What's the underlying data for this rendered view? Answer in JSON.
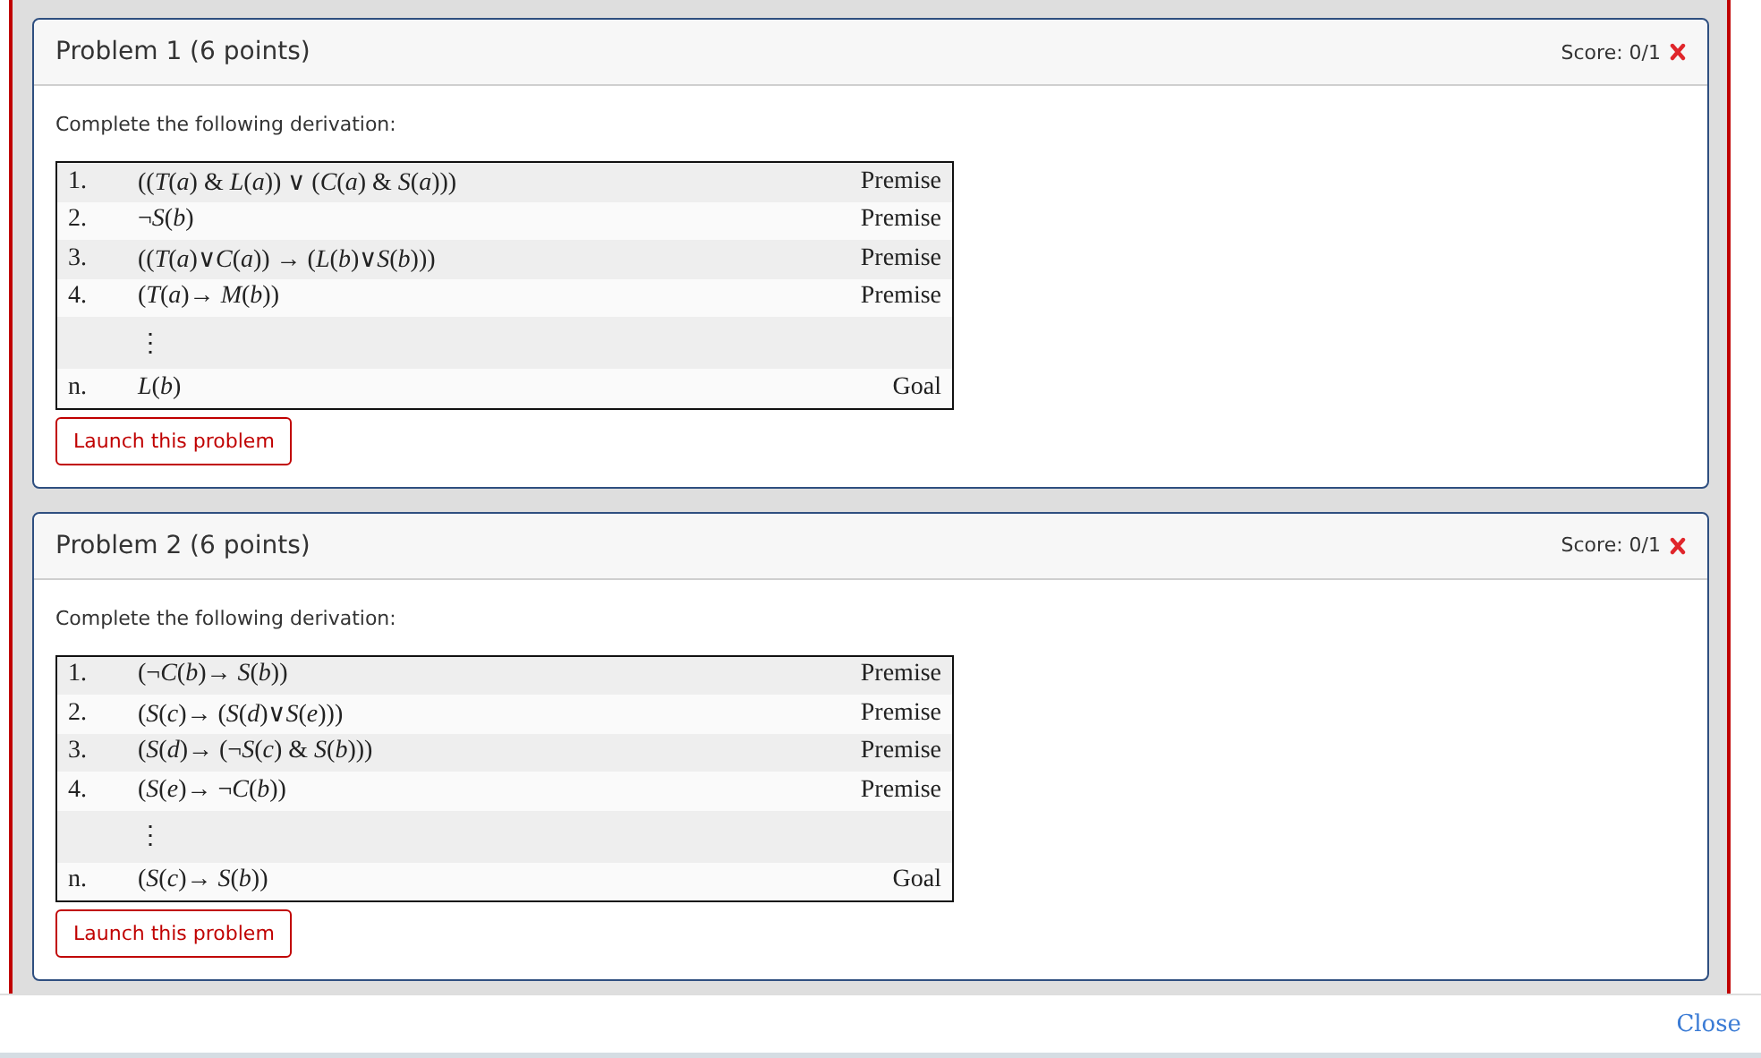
{
  "problems": [
    {
      "title": "Problem 1 (6 points)",
      "score": "Score: 0/1",
      "correct": false,
      "instruction": "Complete the following derivation:",
      "lines": [
        {
          "kind": "line",
          "number": "1.",
          "formula": "((*T*(*a*) & *L*(*a*)) ∨ (*C*(*a*) & *S*(*a*)))",
          "justification": "Premise"
        },
        {
          "kind": "line",
          "number": "2.",
          "formula": "¬*S*(*b*)",
          "justification": "Premise"
        },
        {
          "kind": "line",
          "number": "3.",
          "formula": "((*T*(*a*)∨*C*(*a*)) → (*L*(*b*)∨*S*(*b*)))",
          "justification": "Premise"
        },
        {
          "kind": "line",
          "number": "4.",
          "formula": "(*T*(*a*)→ *M*(*b*))",
          "justification": "Premise"
        },
        {
          "kind": "ellipsis",
          "formula": "⋮"
        },
        {
          "kind": "line",
          "number": "n.",
          "formula": "*L*(*b*)",
          "justification": "Goal"
        }
      ],
      "button": "Launch this problem"
    },
    {
      "title": "Problem 2 (6 points)",
      "score": "Score: 0/1",
      "correct": false,
      "instruction": "Complete the following derivation:",
      "lines": [
        {
          "kind": "line",
          "number": "1.",
          "formula": "(¬*C*(*b*)→ *S*(*b*))",
          "justification": "Premise"
        },
        {
          "kind": "line",
          "number": "2.",
          "formula": "(*S*(*c*)→ (*S*(*d*)∨*S*(*e*)))",
          "justification": "Premise"
        },
        {
          "kind": "line",
          "number": "3.",
          "formula": "(*S*(*d*)→ (¬*S*(*c*) & *S*(*b*)))",
          "justification": "Premise"
        },
        {
          "kind": "line",
          "number": "4.",
          "formula": "(*S*(*e*)→ ¬*C*(*b*))",
          "justification": "Premise"
        },
        {
          "kind": "ellipsis",
          "formula": "⋮"
        },
        {
          "kind": "line",
          "number": "n.",
          "formula": "(*S*(*c*)→ *S*(*b*))",
          "justification": "Goal"
        }
      ],
      "button": "Launch this problem"
    }
  ],
  "footer": {
    "close": "Close"
  }
}
